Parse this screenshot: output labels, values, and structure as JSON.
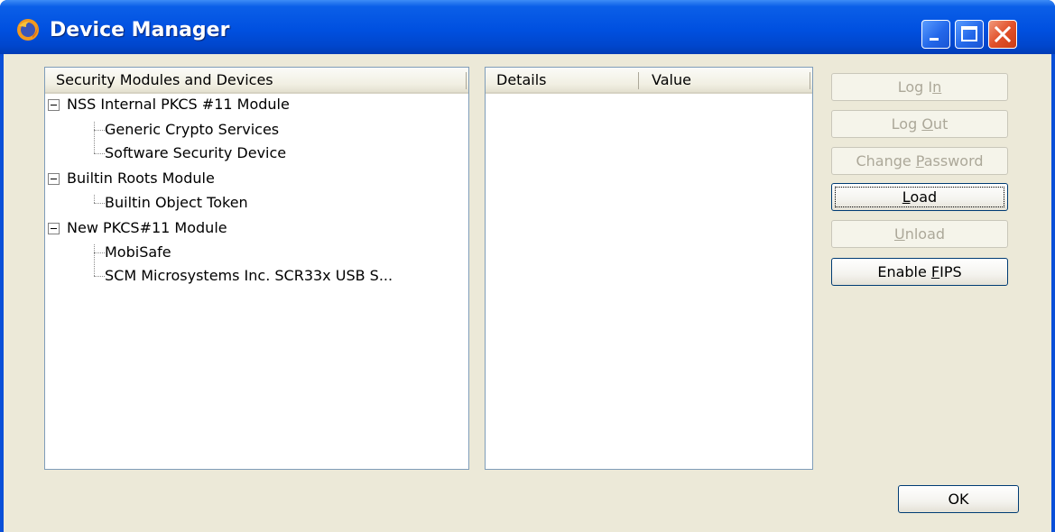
{
  "window": {
    "title": "Device Manager"
  },
  "tree": {
    "header": "Security Modules and Devices",
    "items": [
      {
        "label": "NSS Internal PKCS #11 Module",
        "level": 0
      },
      {
        "label": "Generic Crypto Services",
        "level": 1
      },
      {
        "label": "Software Security Device",
        "level": 1
      },
      {
        "label": "Builtin Roots Module",
        "level": 0
      },
      {
        "label": "Builtin Object Token",
        "level": 1
      },
      {
        "label": "New PKCS#11 Module",
        "level": 0
      },
      {
        "label": "MobiSafe",
        "level": 1
      },
      {
        "label": "SCM Microsystems Inc. SCR33x USB S...",
        "level": 1
      }
    ]
  },
  "details": {
    "columns": [
      "Details",
      "Value"
    ]
  },
  "buttons": {
    "log_in": {
      "pre": "Log I",
      "key": "n",
      "post": "",
      "enabled": false
    },
    "log_out": {
      "pre": "Log ",
      "key": "O",
      "post": "ut",
      "enabled": false
    },
    "change_password": {
      "pre": "Change ",
      "key": "P",
      "post": "assword",
      "enabled": false
    },
    "load": {
      "pre": "",
      "key": "L",
      "post": "oad",
      "enabled": true
    },
    "unload": {
      "pre": "",
      "key": "U",
      "post": "nload",
      "enabled": false
    },
    "enable_fips": {
      "pre": "Enable ",
      "key": "F",
      "post": "IPS",
      "enabled": true
    },
    "ok": "OK"
  },
  "colors": {
    "titlebar": "#0050e0",
    "dialog_bg": "#ece9d8",
    "disabled_text": "#aca899",
    "close_button": "#e2512a"
  }
}
